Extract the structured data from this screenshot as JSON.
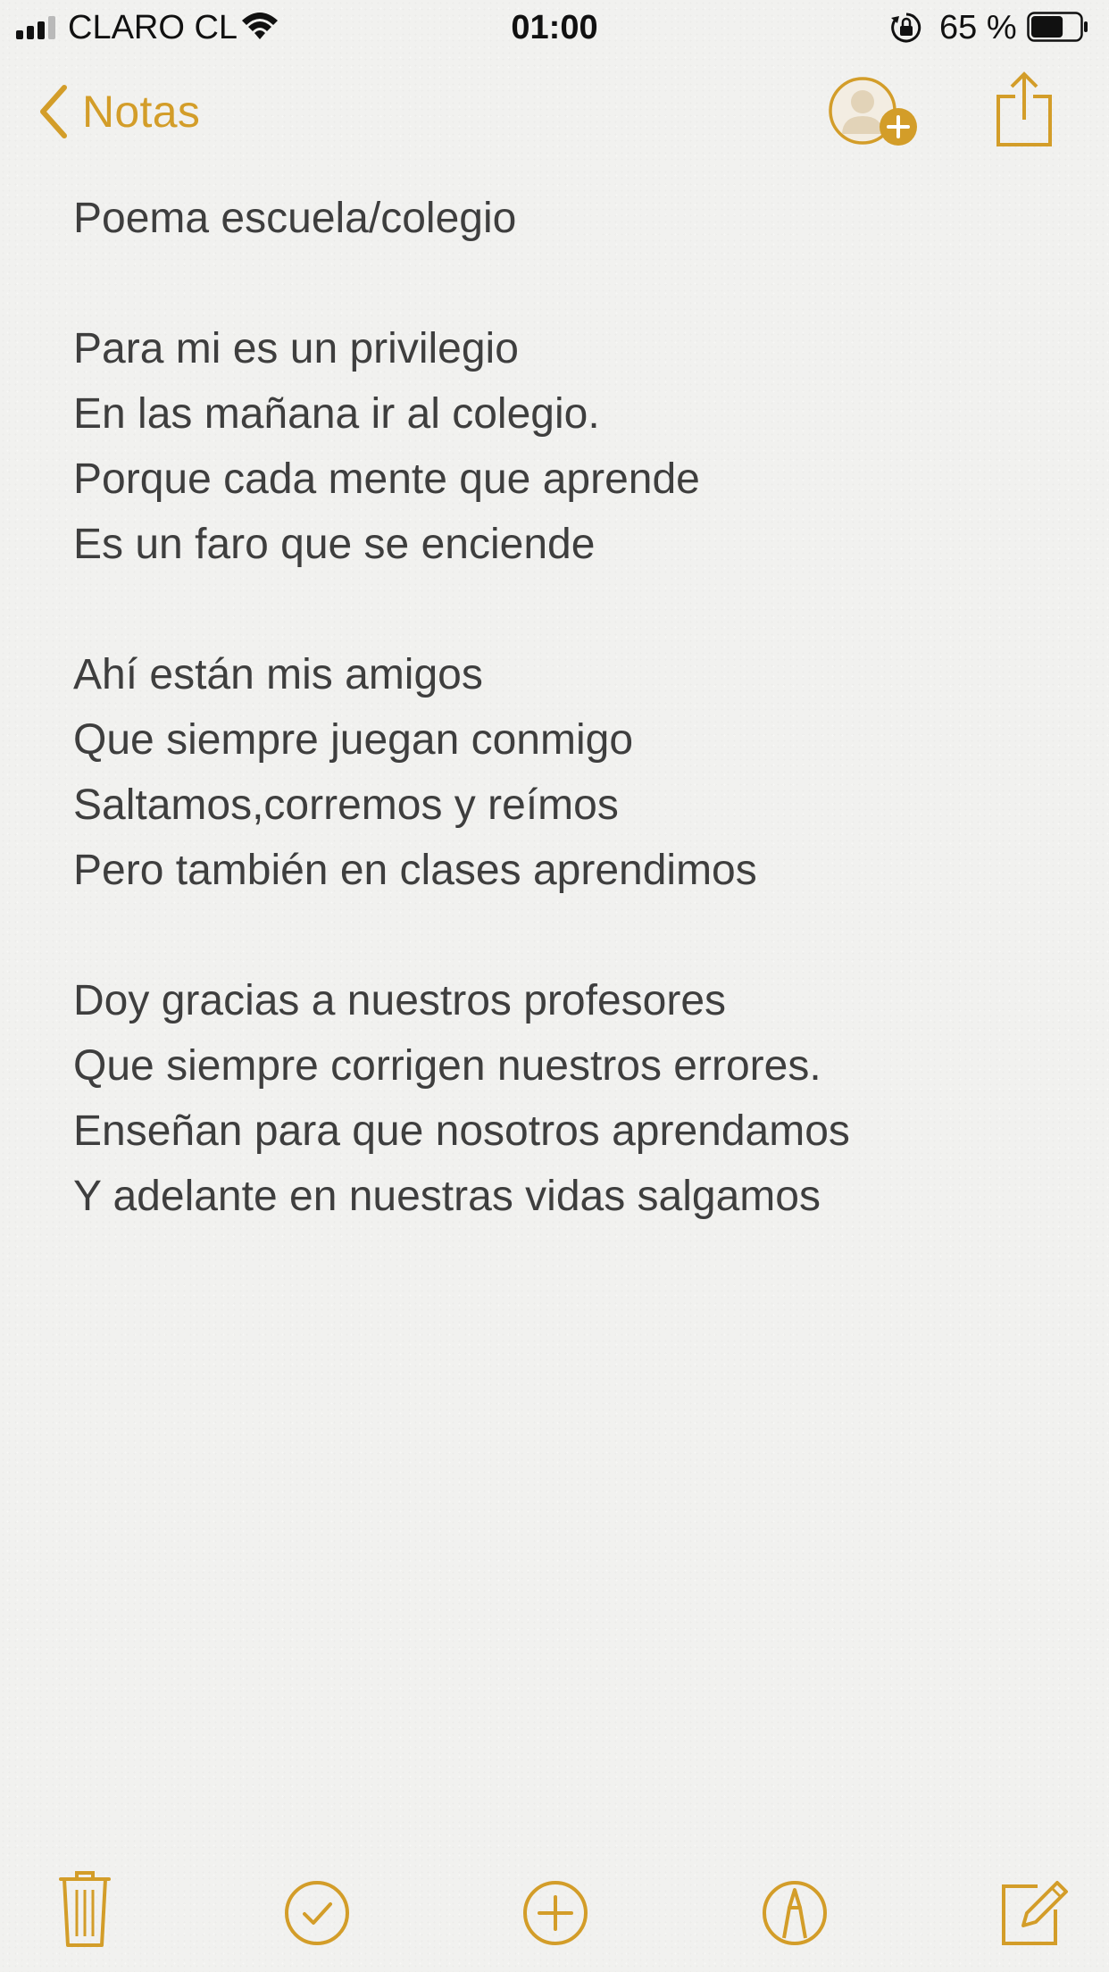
{
  "status_bar": {
    "carrier": "CLARO CL",
    "time": "01:00",
    "battery_percent": "65 %",
    "signal_bars_filled": 3,
    "signal_bars_total": 4,
    "battery_level": 0.65
  },
  "nav": {
    "back_label": "Notas"
  },
  "note": {
    "lines": [
      "Poema escuela/colegio",
      "",
      "Para mi es un privilegio",
      "En las mañana ir al colegio.",
      "Porque cada mente que aprende",
      "Es un faro que se enciende",
      "",
      "Ahí están mis amigos",
      "Que siempre juegan conmigo",
      "Saltamos,corremos y reímos",
      "Pero también en clases aprendimos",
      "",
      "Doy gracias a nuestros profesores",
      "Que siempre corrigen nuestros errores.",
      "Enseñan para que nosotros aprendamos",
      "Y adelante en nuestras vidas salgamos"
    ]
  },
  "toolbar": {
    "items": [
      "trash-icon",
      "checklist-icon",
      "add-icon",
      "markup-icon",
      "compose-icon"
    ]
  },
  "colors": {
    "accent": "#d39d29",
    "text": "#3e3e3e",
    "background": "#f1f1ef"
  }
}
